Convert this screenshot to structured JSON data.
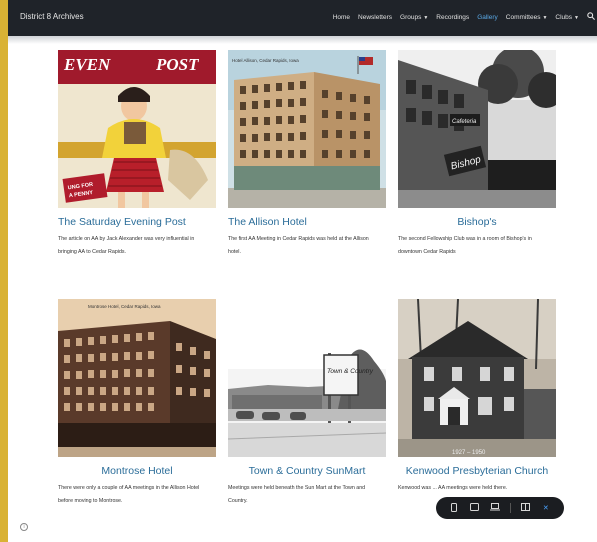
{
  "site": {
    "title": "District 8 Archives"
  },
  "nav": {
    "items": [
      {
        "label": "Home"
      },
      {
        "label": "Newsletters"
      },
      {
        "label": "Groups"
      },
      {
        "label": "Recordings"
      },
      {
        "label": "Gallery"
      },
      {
        "label": "Committees"
      },
      {
        "label": "Clubs"
      }
    ],
    "active": "Gallery",
    "dropdowns": [
      "Groups",
      "Committees",
      "Clubs"
    ]
  },
  "gallery": {
    "cards": [
      {
        "title": "The Saturday Evening Post",
        "description": "The article on AA by Jack Alexander was very influential in bringing AA to Cedar Rapids.",
        "photo_text": {
          "masthead_left": "EVEN",
          "masthead_right": "POST",
          "badge_line1": "UNG FOR",
          "badge_line2": "A PENNY"
        }
      },
      {
        "title": "The Allison Hotel",
        "description": "The first AA Meeting in Cedar Rapids was held at the Allison hotel.",
        "photo_text": {
          "caption": "Hotel Allison, Cedar Rapids, Iowa"
        }
      },
      {
        "title": "Bishop's",
        "description": "The second Fellowship Club was in a room of Bishop's in downtown Cedar Rapids",
        "photo_text": {
          "sign_a": "Bishop",
          "sign_b": "Cafeteria"
        }
      },
      {
        "title": "Montrose Hotel",
        "description": "There were only a couple of AA meetings in the Allison Hotel before moving to Montrose.",
        "photo_text": {
          "caption": "Montrose Hotel, Cedar Rapids, Iowa"
        }
      },
      {
        "title": "Town & Country SunMart",
        "description": "Meetings were held beneath the Sun Mart at the Town and Country.",
        "photo_text": {
          "sign": "Town & Country"
        }
      },
      {
        "title": "Kenwood Presbyterian Church",
        "description": "Kenwood was ... AA meetings were held there.",
        "photo_text": {
          "years": "1927 – 1950"
        }
      }
    ]
  },
  "device_bar": {
    "icons": [
      "phone-icon",
      "tablet-icon",
      "laptop-icon",
      "split-view-icon",
      "close-icon"
    ]
  },
  "colors": {
    "accent_border": "#d9b234",
    "topbar": "#1f2329",
    "link": "#2b6d99",
    "nav_active": "#5aa9e6"
  }
}
